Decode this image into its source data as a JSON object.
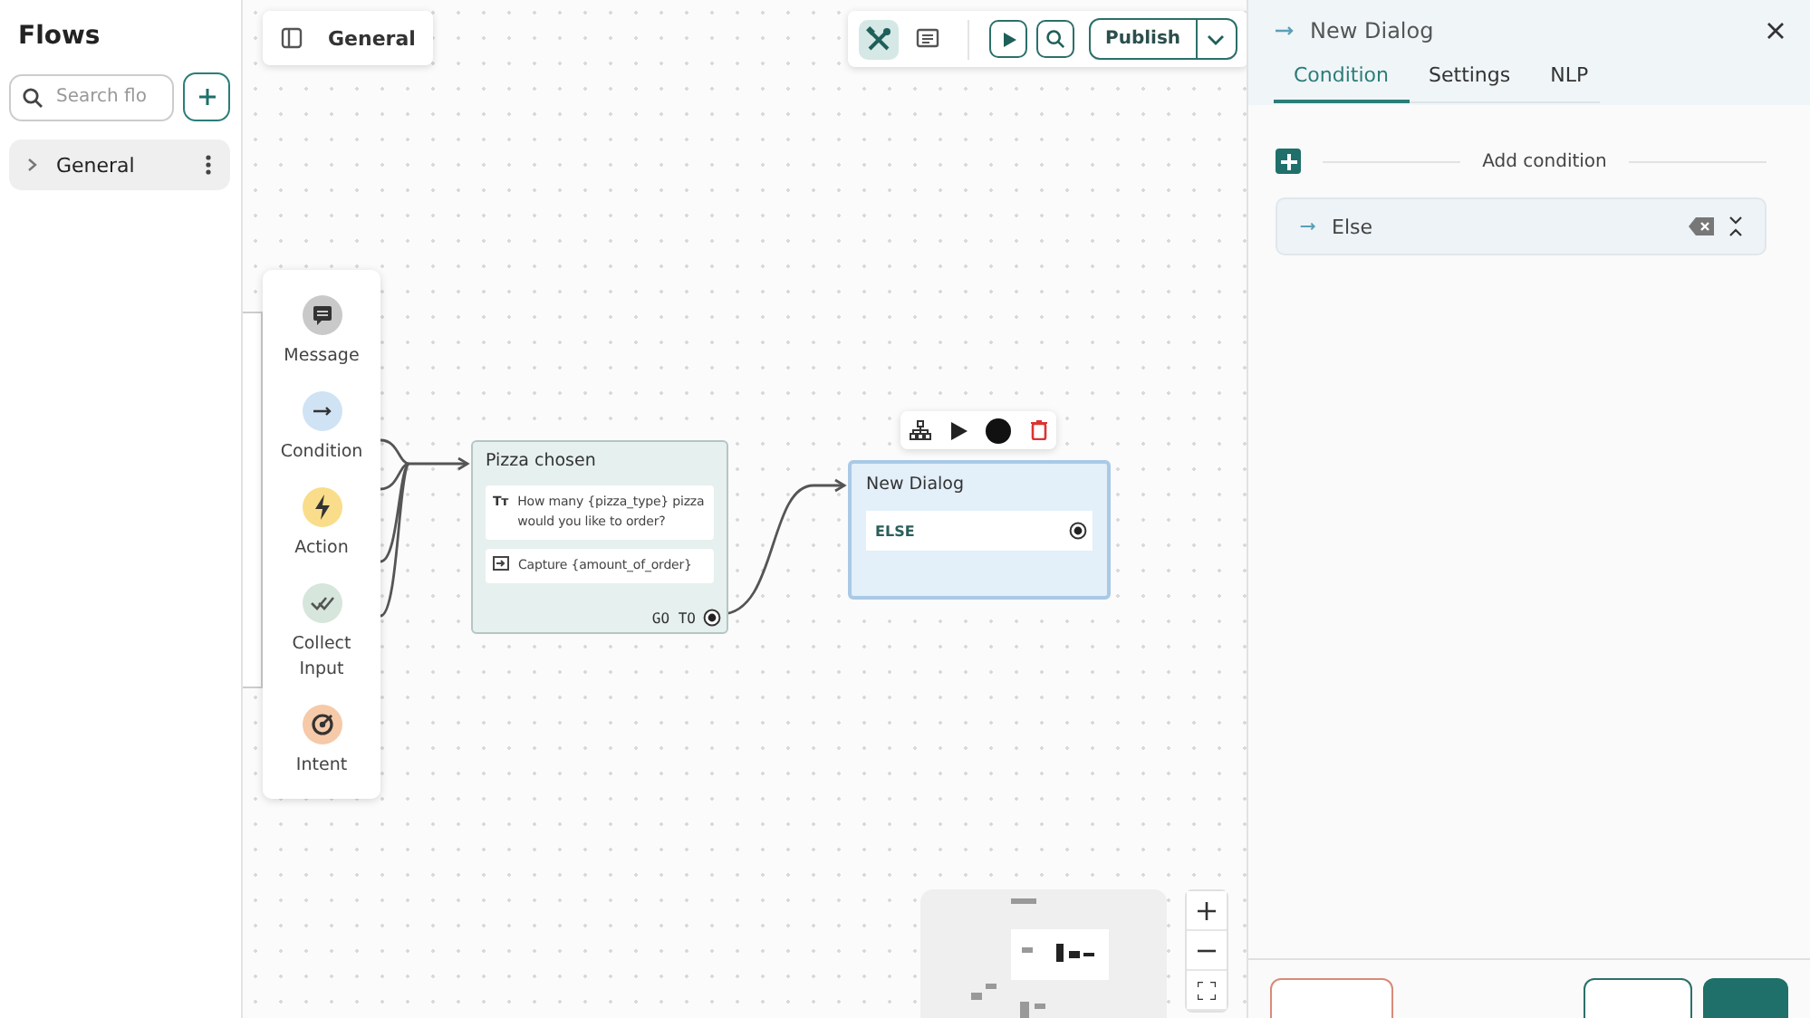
{
  "sidebar": {
    "title": "Flows",
    "search": {
      "placeholder": "Search flo"
    },
    "flows": [
      {
        "label": "General",
        "expanded": false,
        "selected": true
      }
    ]
  },
  "canvas": {
    "flow_tab": "General",
    "toolbar": {
      "tools": [
        {
          "kind": "build",
          "selected": true
        },
        {
          "kind": "comments",
          "selected": false
        }
      ],
      "publish": "Publish"
    },
    "palette": [
      {
        "kind": "message",
        "label": "Message"
      },
      {
        "kind": "condition",
        "label": "Condition"
      },
      {
        "kind": "action",
        "label": "Action"
      },
      {
        "kind": "collect",
        "label": "Collect Input"
      },
      {
        "kind": "intent",
        "label": "Intent"
      }
    ],
    "pizza_node": {
      "title": "Pizza chosen",
      "steps": [
        {
          "kind": "text",
          "icon": "Tт",
          "text": "How many {pizza_type} pizza would you like to order?"
        },
        {
          "kind": "capture",
          "text": "Capture {amount_of_order}"
        }
      ],
      "goto": "GO TO"
    },
    "dialog_node": {
      "title": "New Dialog",
      "selected": true,
      "conditions": [
        "ELSE"
      ]
    }
  },
  "panel": {
    "title": "New Dialog",
    "tabs": [
      {
        "label": "Condition",
        "selected": true
      },
      {
        "label": "Settings",
        "selected": false
      },
      {
        "label": "NLP",
        "selected": false
      }
    ],
    "add_condition": "Add condition",
    "conditions": [
      {
        "label": "Else"
      }
    ]
  }
}
